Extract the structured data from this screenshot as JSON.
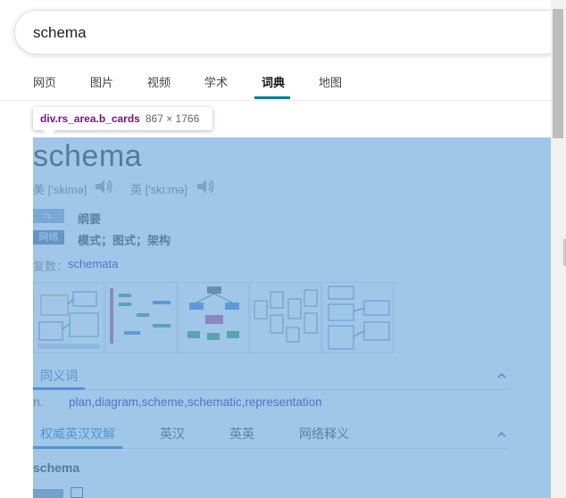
{
  "search": {
    "value": "schema"
  },
  "tabs": [
    {
      "label": "网页",
      "active": false
    },
    {
      "label": "图片",
      "active": false
    },
    {
      "label": "视频",
      "active": false
    },
    {
      "label": "学术",
      "active": false
    },
    {
      "label": "词典",
      "active": true
    },
    {
      "label": "地图",
      "active": false
    }
  ],
  "tooltip": {
    "tag": "div.rs_area.b_cards",
    "size": "867 × 1766"
  },
  "entry": {
    "word": "schema",
    "pron_us": "美 ['skimə]",
    "pron_uk": "英 ['skiːmə]",
    "definitions": [
      {
        "pos": "n.",
        "text": "纲要",
        "badge_color": "#8faad0"
      },
      {
        "pos": "网络",
        "text": "模式；图式；架构",
        "badge_color": "#53709a"
      }
    ],
    "plural_label": "复数：",
    "plural_value": "schemata"
  },
  "synonyms": {
    "title": "同义词",
    "pos": "n.",
    "list": "plan,diagram,scheme,schematic,representation"
  },
  "def_tabs": {
    "items": [
      "权威英汉双解",
      "英汉",
      "英英",
      "网络释义"
    ],
    "active": 0
  },
  "bottom": {
    "word": "schema"
  },
  "colors": {
    "overlay": "#6fa8dc",
    "accent": "#00809d",
    "link": "#1a0dab",
    "section_active": "#1a6fb5",
    "tooltip_tag": "#881280"
  },
  "icons": [
    "speaker-icon",
    "chevron-up-icon"
  ]
}
